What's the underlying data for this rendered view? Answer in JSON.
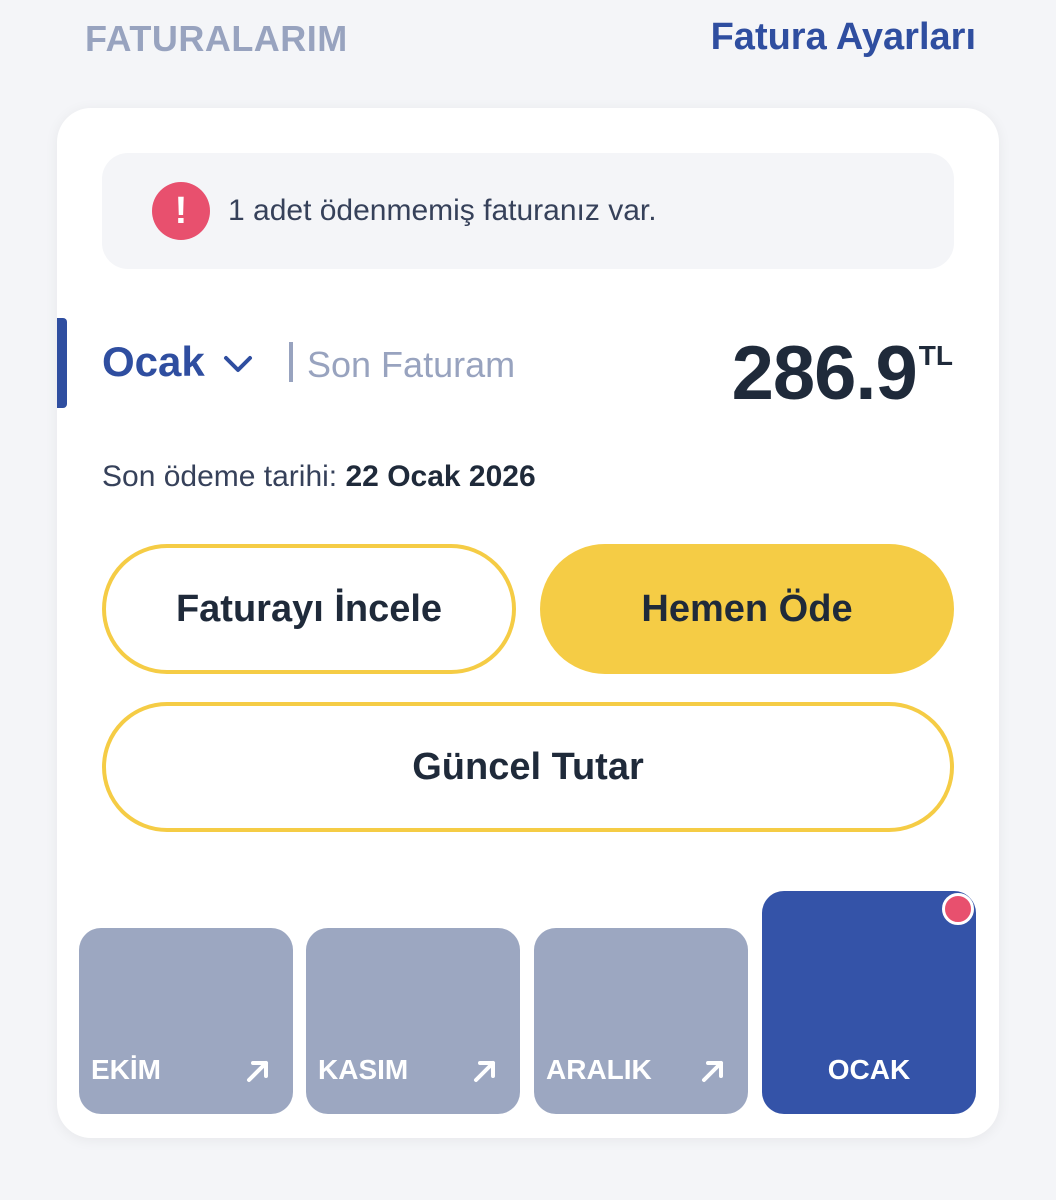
{
  "header": {
    "title": "FATURALARIM",
    "settings_label": "Fatura Ayarları"
  },
  "alert": {
    "icon": "exclamation-icon",
    "icon_glyph": "!",
    "text": "1 adet ödenmemiş faturanız var."
  },
  "invoice": {
    "month": "Ocak",
    "last_invoice_label": "Son Faturam",
    "amount": "286.9",
    "currency": "TL",
    "due_label": "Son ödeme tarihi:",
    "due_date": "22 Ocak 2026"
  },
  "buttons": {
    "review": "Faturayı İncele",
    "pay": "Hemen Öde",
    "current": "Güncel Tutar"
  },
  "months": [
    {
      "label": "EKİM",
      "icon": "arrow-up-right-icon"
    },
    {
      "label": "KASIM",
      "icon": "arrow-up-right-icon"
    },
    {
      "label": "ARALIK",
      "icon": "arrow-up-right-icon"
    },
    {
      "label": "OCAK",
      "active": true
    }
  ],
  "colors": {
    "brand_blue": "#2f4ea0",
    "accent_yellow": "#f5cc45",
    "alert_red": "#e8506e",
    "tile_gray": "#9ca7c1",
    "tile_active": "#3453a8"
  }
}
